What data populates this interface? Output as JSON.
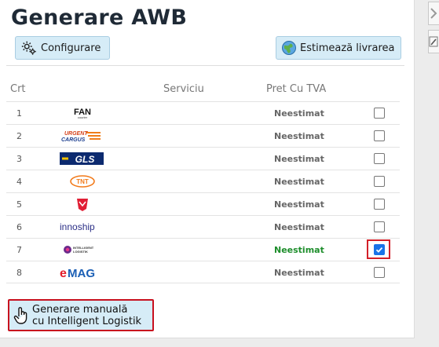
{
  "page": {
    "title": "Generare AWB"
  },
  "toolbar": {
    "configure_label": "Configurare",
    "estimate_label": "Estimează livrarea"
  },
  "table": {
    "headers": {
      "crt": "Crt",
      "service": "Serviciu",
      "price": "Pret Cu TVA"
    },
    "rows": [
      {
        "n": "1",
        "logo": "FAN Courier",
        "price": "Neestimat",
        "checked": false
      },
      {
        "n": "2",
        "logo": "Urgent Cargus",
        "price": "Neestimat",
        "checked": false
      },
      {
        "n": "3",
        "logo": "GLS",
        "price": "Neestimat",
        "checked": false
      },
      {
        "n": "4",
        "logo": "TNT",
        "price": "Neestimat",
        "checked": false
      },
      {
        "n": "5",
        "logo": "Sameday",
        "price": "Neestimat",
        "checked": false
      },
      {
        "n": "6",
        "logo": "innoship",
        "price": "Neestimat",
        "checked": false
      },
      {
        "n": "7",
        "logo": "Intelligent Logistik",
        "price": "Neestimat",
        "checked": true
      },
      {
        "n": "8",
        "logo": "eMAG",
        "price": "Neestimat",
        "checked": false
      }
    ]
  },
  "manual_button": {
    "line1": "Generare manuală",
    "line2": "cu Intelligent Logistik"
  },
  "colors": {
    "accent": "#1a73e8",
    "highlight": "#d32029",
    "button_bg": "#d6ecf7",
    "estimated_green": "#1e8e2c"
  }
}
